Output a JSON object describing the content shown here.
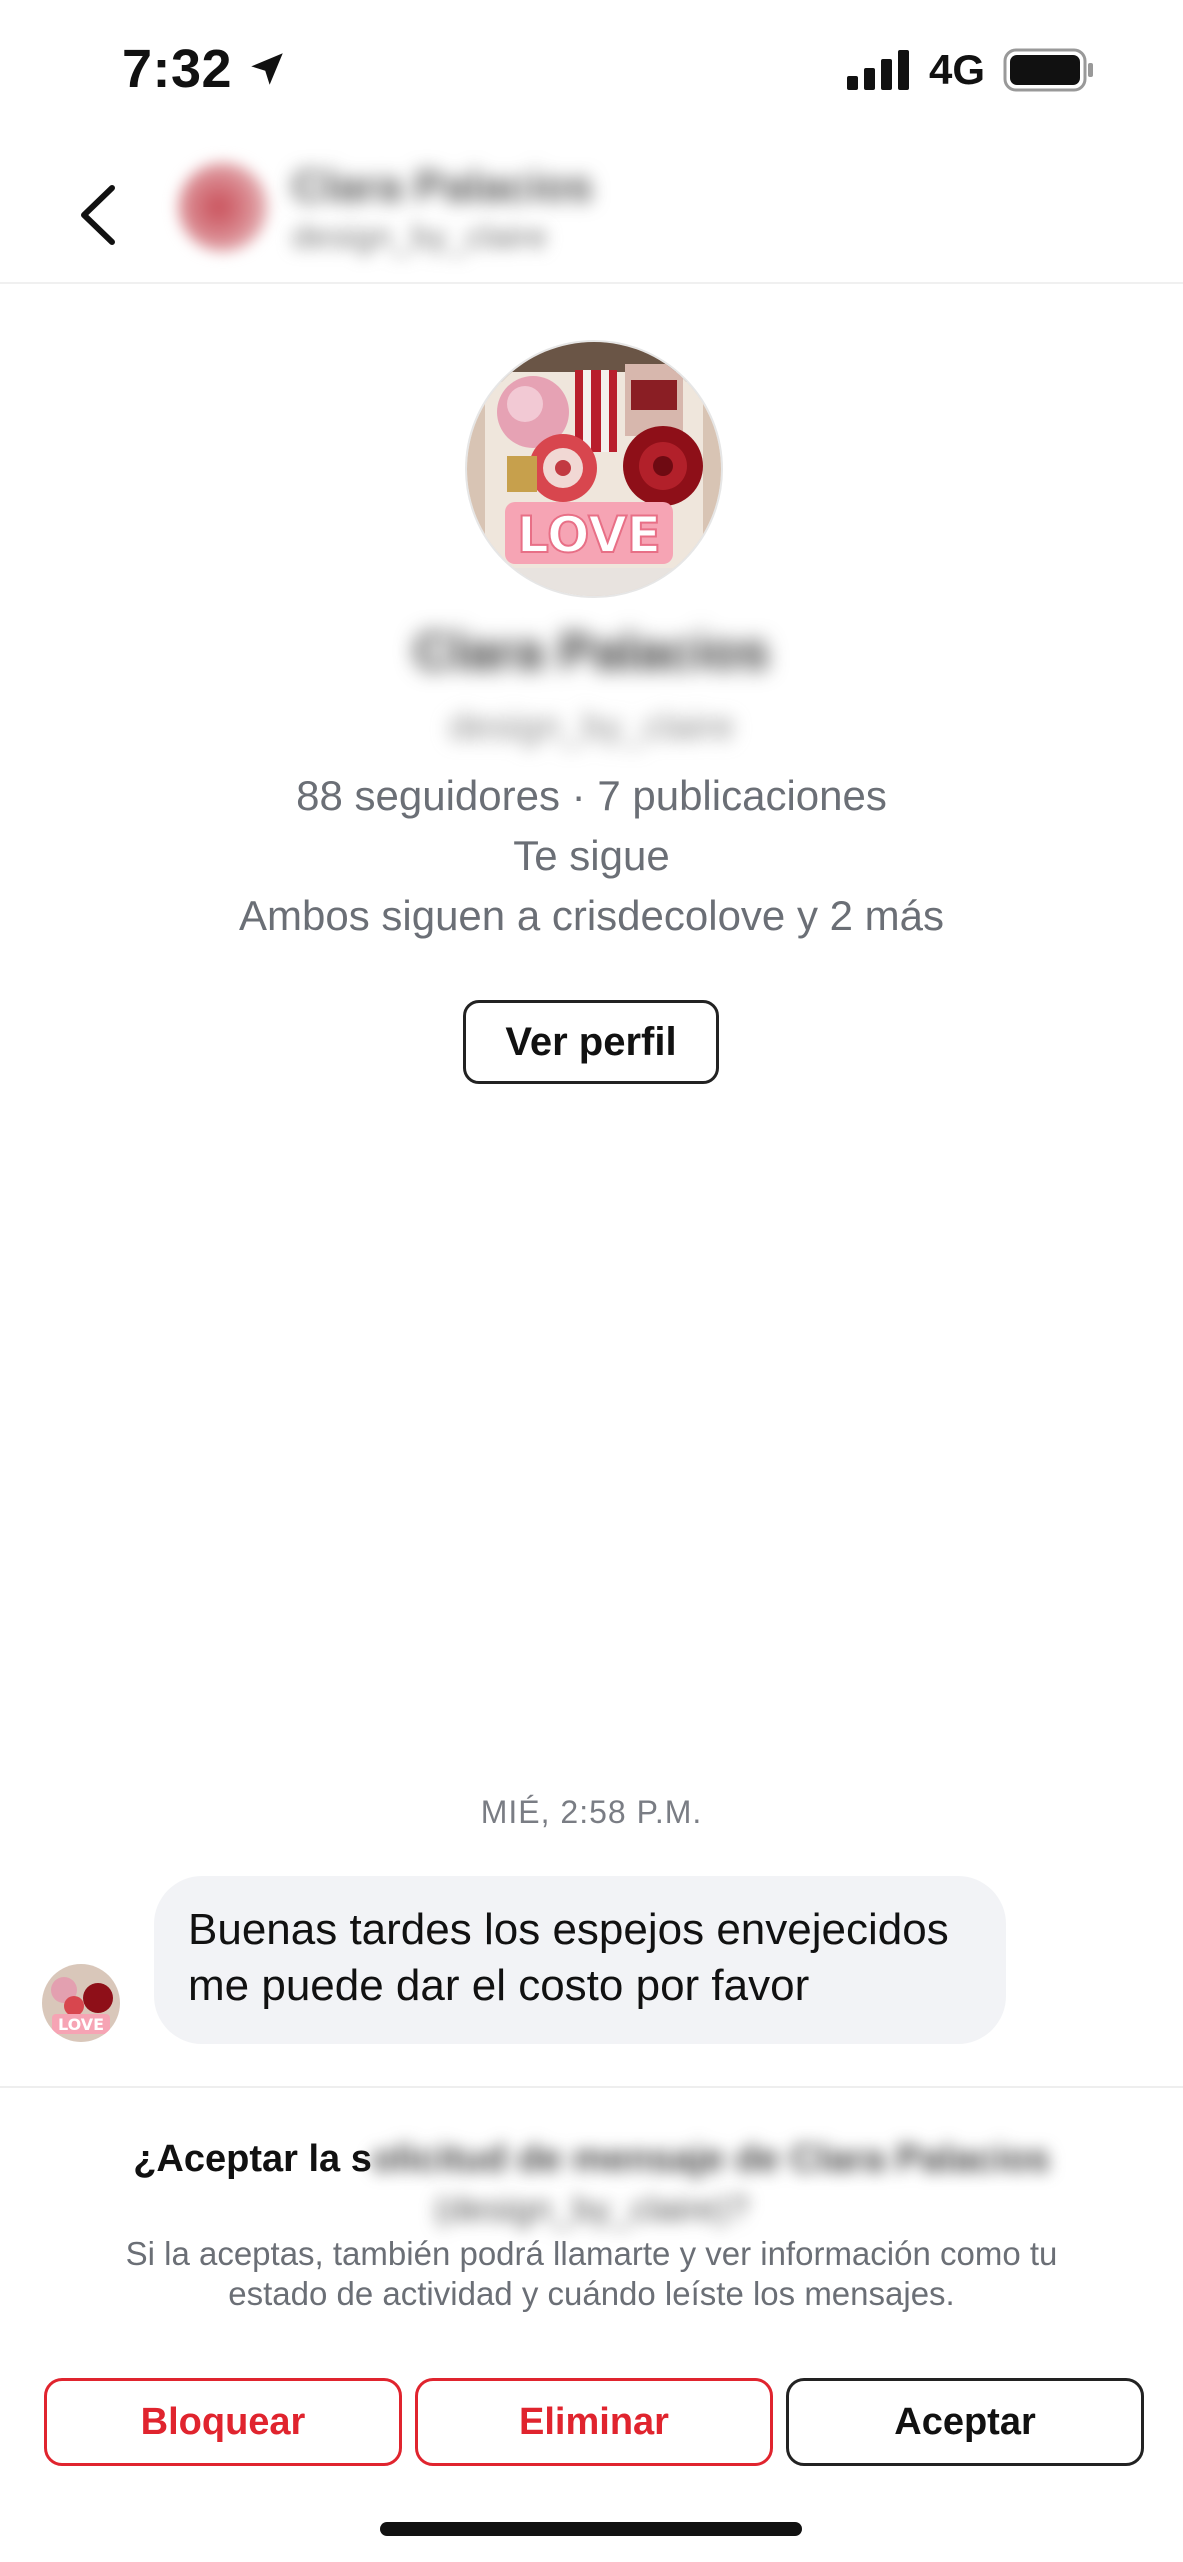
{
  "status_bar": {
    "time": "7:32",
    "network": "4G",
    "icons": [
      "location-arrow-icon",
      "signal-bars-icon",
      "battery-icon"
    ]
  },
  "header": {
    "name": "Clara Palacios",
    "handle": "design_by_claire"
  },
  "profile": {
    "name": "Clara Palacios",
    "handle": "design_by_claire",
    "stats": "88 seguidores · 7 publicaciones",
    "follows_you": "Te sigue",
    "mutual": "Ambos siguen a crisdecolove y 2 más",
    "view_profile_label": "Ver perfil",
    "photo_text": "LOVE"
  },
  "conversation": {
    "timestamp": "MIÉ, 2:58 P.M.",
    "messages": [
      {
        "line1": "Buenas tardes los espejos envejecidos",
        "line2": "me puede dar el costo por favor"
      }
    ]
  },
  "request": {
    "title_prefix": "¿Aceptar la s",
    "title_blurred": "olicitud de mensaje de Clara Palacios",
    "title_line2_blurred": "(design_by_claire)?",
    "description": "Si la aceptas, también podrá llamarte y ver información como tu estado de actividad y cuándo leíste los mensajes.",
    "block_label": "Bloquear",
    "delete_label": "Eliminar",
    "accept_label": "Aceptar"
  },
  "colors": {
    "danger": "#e0242e",
    "bubble": "#f2f3f6",
    "muted_text": "#6b6f76"
  }
}
